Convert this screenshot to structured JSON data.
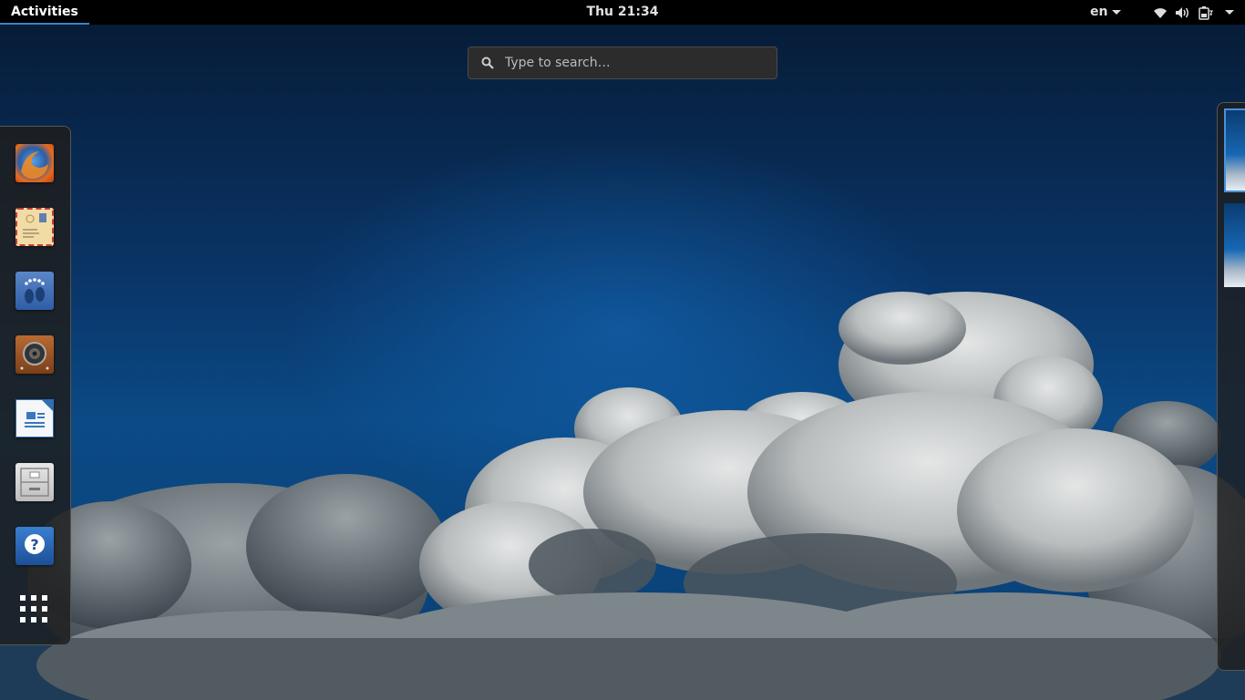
{
  "topbar": {
    "activities_label": "Activities",
    "clock": "Thu 21:34",
    "language": "en",
    "tray_icons": [
      "wifi-icon",
      "volume-icon",
      "battery-icon",
      "menu-arrow-icon"
    ]
  },
  "search": {
    "placeholder": "Type to search…"
  },
  "dash": {
    "apps": [
      {
        "name": "firefox",
        "icon": "firefox-icon"
      },
      {
        "name": "mail",
        "icon": "mail-icon"
      },
      {
        "name": "footprints",
        "icon": "footprints-icon"
      },
      {
        "name": "music",
        "icon": "speaker-icon"
      },
      {
        "name": "writer",
        "icon": "writer-icon"
      },
      {
        "name": "files",
        "icon": "file-cabinet-icon"
      },
      {
        "name": "help",
        "icon": "help-icon"
      },
      {
        "name": "show-applications",
        "icon": "app-grid-icon"
      }
    ]
  },
  "workspaces": {
    "count": 2,
    "active_index": 0
  },
  "colors": {
    "topbar_bg": "#000000",
    "accent": "#3b82c4",
    "dash_bg": "#1e1e1e"
  }
}
